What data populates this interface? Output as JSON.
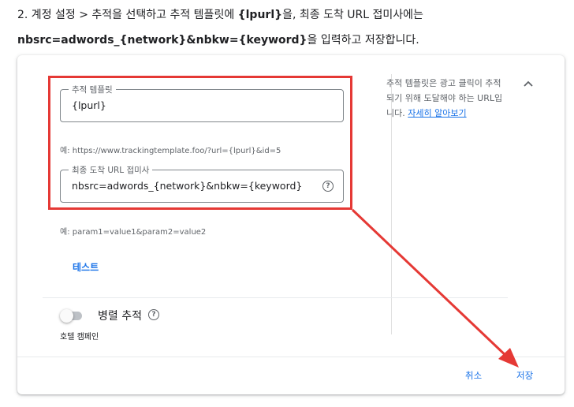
{
  "instructions": {
    "line1_prefix": "2. 계정 설정 > 추적을 선택하고 추적 템플릿에 ",
    "line1_bold": "{lpurl}",
    "line1_suffix": "을, 최종 도착 URL 접미사에는",
    "line2_bold": "nbsrc=adwords_{network}&nbkw={keyword}",
    "line2_suffix": "을 입력하고 저장합니다."
  },
  "tracking_template": {
    "label": "추적 템플릿",
    "value": "{lpurl}",
    "hint": "예: https://www.trackingtemplate.foo/?url={lpurl}&id=5"
  },
  "final_url_suffix": {
    "label": "최종 도착 URL 접미사",
    "value": "nbsrc=adwords_{network}&nbkw={keyword}",
    "hint": "예: param1=value1&param2=value2"
  },
  "side_help": {
    "text": "추적 템플릿은 광고 클릭이 추적되기 위해 도달해야 하는 URL입니다.",
    "link": "자세히 알아보기"
  },
  "test_button": "테스트",
  "parallel_tracking": {
    "label": "병렬 추적",
    "state": "off"
  },
  "hotel_campaign": "호텔 캠페인",
  "footer": {
    "cancel": "취소",
    "save": "저장"
  },
  "colors": {
    "accent": "#1a73e8",
    "annotation_red": "#e53935"
  }
}
